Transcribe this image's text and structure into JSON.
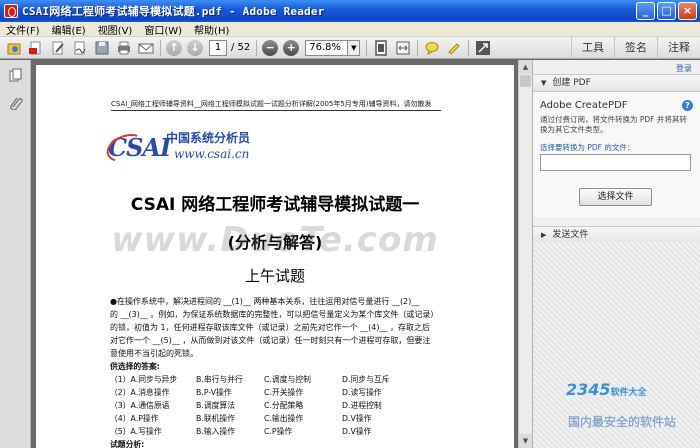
{
  "window": {
    "title": "CSAI网络工程师考试辅导模拟试题.pdf - Adobe Reader",
    "minimize": "_",
    "maximize": "□",
    "close": "×"
  },
  "menu": [
    "文件(F)",
    "编辑(E)",
    "视图(V)",
    "窗口(W)",
    "帮助(H)"
  ],
  "toolbar": {
    "page_current": "1",
    "page_total": "/ 52",
    "zoom": "76.8%",
    "right_links": [
      "工具",
      "签名",
      "注释"
    ]
  },
  "document": {
    "header_line": "CSAI_网络工程师辅导资料__网络工程师模拟试题一试题分析详解(2005年5月专用)辅导资料，请勿散发",
    "logo_cn": "中国系统分析员",
    "logo_mark": "CSAI",
    "logo_url": "www.csai.cn",
    "title1": "CSAI 网络工程师考试辅导模拟试题一",
    "title2": "(分析与解答)",
    "title3": "上午试题",
    "watermark": "www.DuoTe.com",
    "paragraph": [
      "●在操作系统中，解决进程间的 __(1)__ 两种基本关系，往往运用对信号量进行 __(2)__",
      "的 __(3)__ 。例如，为保证系统数据库的完整性，可以把信号量定义为某个库文件（或记录）",
      "的锁，初值为 1，任何进程存取该库文件（或记录）之前先对它作一个 __(4)__ ，存取之后",
      "对它作一个 __(5)__ ，从而做到对该文件（或记录）任一时刻只有一个进程可存取，但要注",
      "意使用不当引起的死锁。"
    ],
    "options_label": "供选择的答案:",
    "options": [
      [
        "（1）A.同步与异步",
        "B.串行与并行",
        "C.调度与控制",
        "D.同步与互斥"
      ],
      [
        "（2）A.消息操作",
        "B.P-V操作",
        "C.开关操作",
        "D.读写操作"
      ],
      [
        "（3）A.通信原语",
        "B.调度算法",
        "C.分配策略",
        "D.进程控制"
      ],
      [
        "（4）A.P操作",
        "B.联机操作",
        "C.输出操作",
        "D.V操作"
      ],
      [
        "（5）A.写操作",
        "B.输入操作",
        "C.P操作",
        "D.V操作"
      ]
    ],
    "analysis_label": "试题分析:"
  },
  "right_panel": {
    "hide": "登录",
    "section1_title": "创建 PDF",
    "create_title": "Adobe CreatePDF",
    "create_desc": "通过付费订阅，将文件转换为 PDF 并将其转换为其它文件类型。",
    "select_label": "选择要转换为 PDF 的文件：",
    "select_button": "选择文件",
    "section2_title": "发送文件"
  },
  "overlay": {
    "brand": "2345",
    "brand_suffix": "软件大全",
    "brand_sub": "国内最安全的软件站"
  },
  "colors": {
    "titlebar": "#1657d8",
    "accent_blue": "#2b4aa6",
    "link_blue": "#2a5db0"
  }
}
